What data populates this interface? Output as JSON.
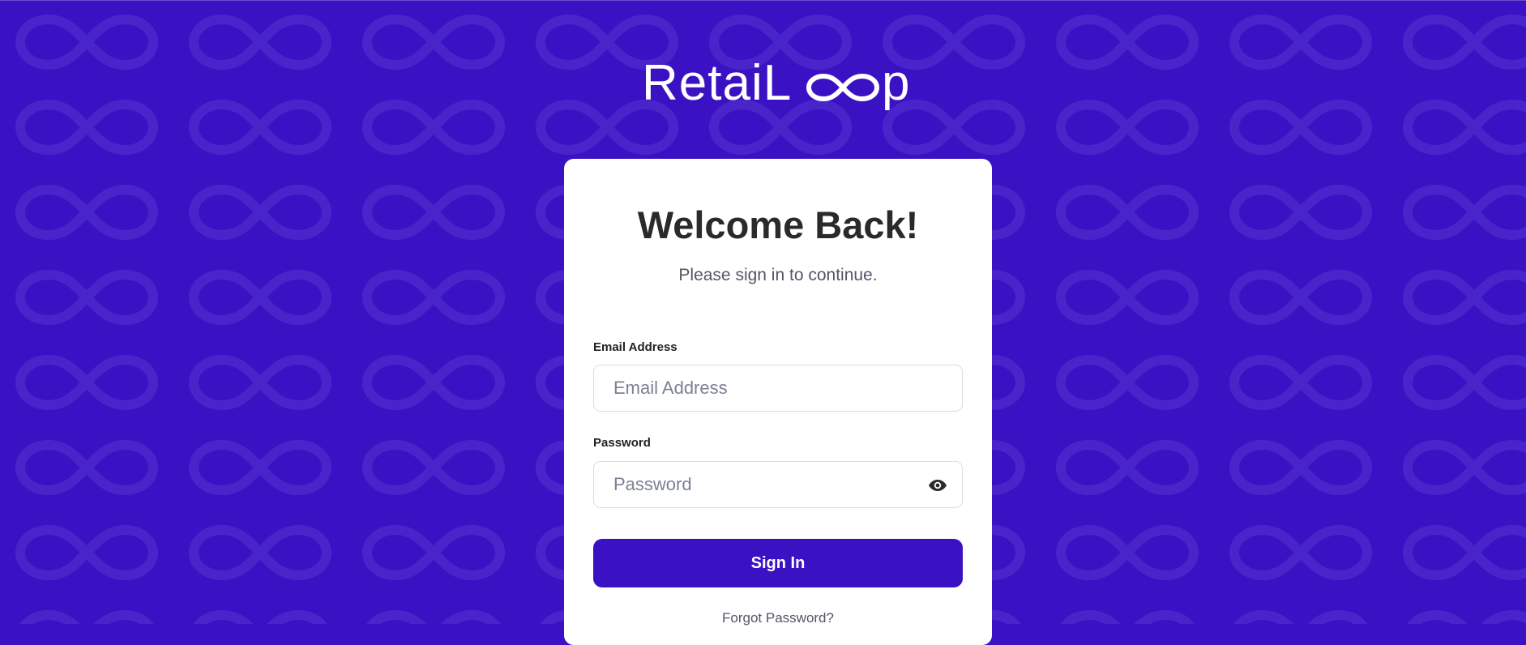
{
  "brand": {
    "name_left": "RetaiL",
    "name_right": "p",
    "colors": {
      "background": "#3b12c3",
      "pattern": "#4a24cb",
      "primary_button": "#3b12c3"
    }
  },
  "login": {
    "title": "Welcome Back!",
    "subtitle": "Please sign in to continue.",
    "email": {
      "label": "Email Address",
      "placeholder": "Email Address",
      "value": ""
    },
    "password": {
      "label": "Password",
      "placeholder": "Password",
      "value": "",
      "toggle_icon": "eye-icon"
    },
    "submit_label": "Sign In",
    "forgot_label": "Forgot Password?"
  }
}
